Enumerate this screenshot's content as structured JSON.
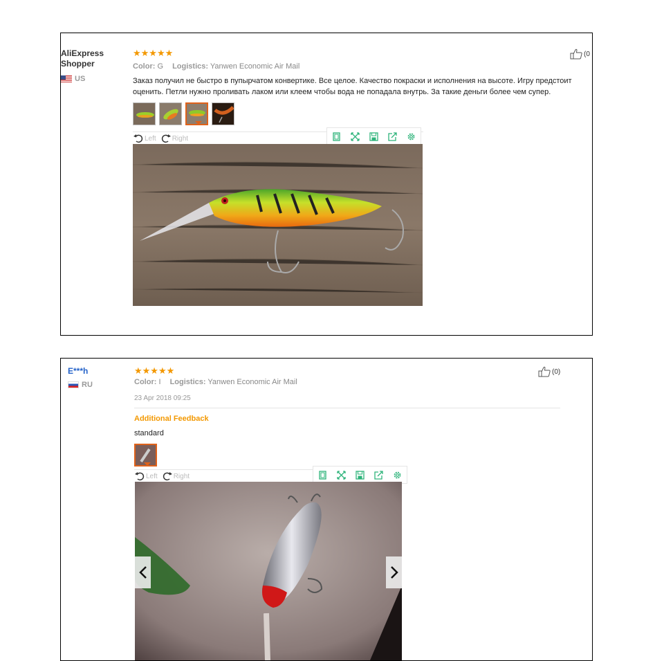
{
  "reviews": [
    {
      "user": "AliExpress Shopper",
      "user_line1": "AliExpress",
      "user_line2": "Shopper",
      "country": "US",
      "stars": "★★★★★",
      "color_label": "Color:",
      "color_value": "G",
      "logistics_label": "Logistics:",
      "logistics_value": "Yanwen Economic Air Mail",
      "text": "Заказ получил не быстро в пупырчатом конвертике. Все целое. Качество покраски и исполнения на высоте. Игру предстоит оценить. Петли нужно проливать лаком или клеем чтобы вода не попадала внутрь. За такие деньги более чем супер.",
      "helpful": "(0",
      "rotate_left": "Left",
      "rotate_right": "Right"
    },
    {
      "user": "E***h",
      "country": "RU",
      "stars": "★★★★★",
      "color_label": "Color:",
      "color_value": "I",
      "logistics_label": "Logistics:",
      "logistics_value": "Yanwen Economic Air Mail",
      "date": "23 Apr 2018 09:25",
      "additional_feedback_label": "Additional Feedback",
      "additional_feedback_text": "standard",
      "helpful": "(0)",
      "rotate_left": "Left",
      "rotate_right": "Right"
    }
  ],
  "icons": {
    "tools": [
      "fit-screen-icon",
      "fullscreen-icon",
      "save-icon",
      "share-icon",
      "settings-icon"
    ],
    "accent": "#f39800",
    "tool_color": "#2db37a",
    "active_border": "#e0621a"
  }
}
